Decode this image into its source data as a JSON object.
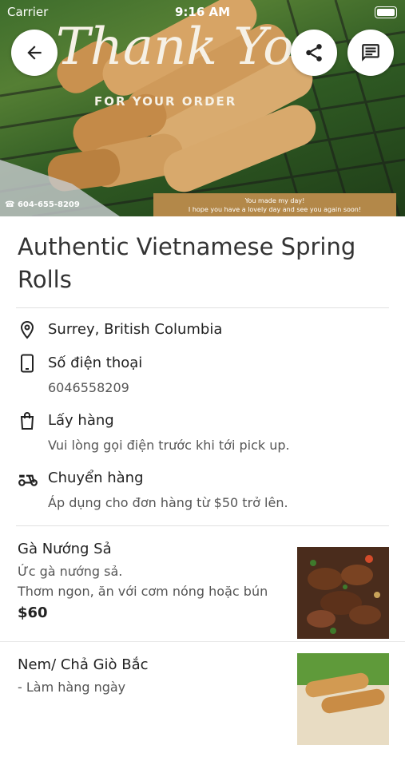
{
  "status_bar": {
    "carrier": "Carrier",
    "time": "9:16 AM"
  },
  "hero": {
    "thank_you_text": "Thank You",
    "for_your_order": "FOR YOUR ORDER",
    "phone_tag": "604-655-8209",
    "banner_line1": "You made my day!",
    "banner_line2": "I hope you have a lovely day and see you again soon!"
  },
  "header_buttons": {
    "back": "arrow-left-icon",
    "share": "share-icon",
    "chat": "message-icon"
  },
  "title": "Authentic Vietnamese Spring Rolls",
  "info": {
    "location": "Surrey, British Columbia",
    "phone_label": "Số điện thoại",
    "phone_value": "6046558209",
    "pickup_label": "Lấy hàng",
    "pickup_note": "Vui lòng gọi điện trước khi tới pick up.",
    "delivery_label": "Chuyển hàng",
    "delivery_note": "Áp dụng cho đơn hàng từ $50 trở lên."
  },
  "products": [
    {
      "name": "Gà Nướng Sả",
      "description": "Ức gà nướng sả.\nThơm ngon, ăn với cơm nóng hoặc bún",
      "price": "$60"
    },
    {
      "name": "Nem/ Chả Giò Bắc",
      "description": "- Làm hàng ngày",
      "price": ""
    }
  ],
  "colors": {
    "banner": "#b38849",
    "text": "#222222",
    "subtext": "#555555",
    "divider": "#e0e0e0"
  }
}
